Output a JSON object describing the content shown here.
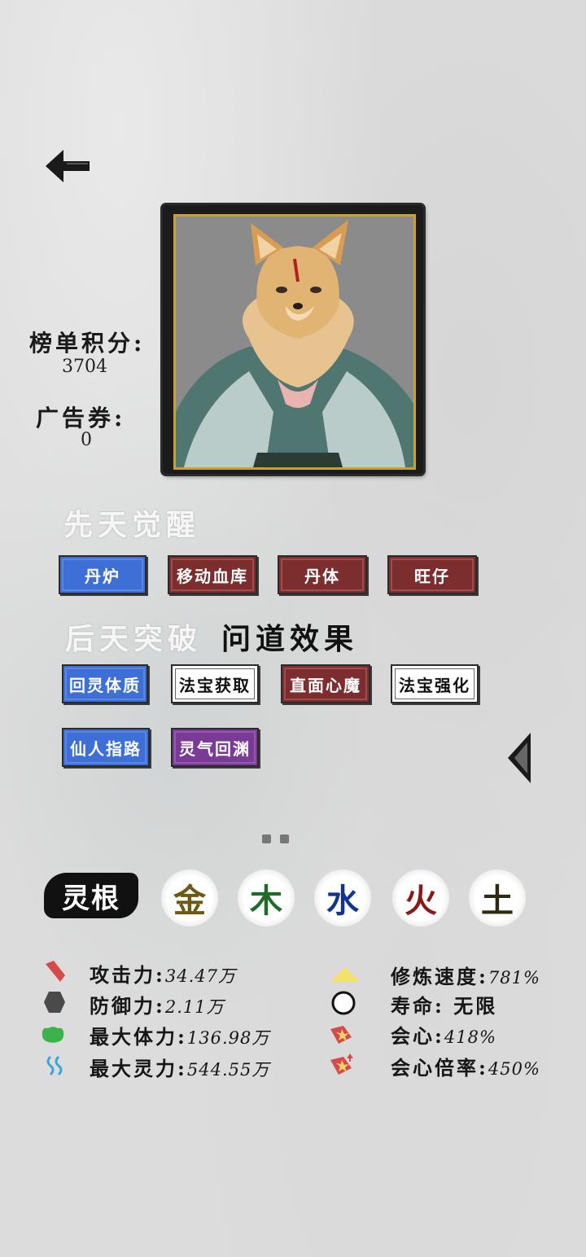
{
  "ranking": {
    "label": "榜单积分:",
    "value": "3704"
  },
  "ad_ticket": {
    "label": "广告券:",
    "value": "0"
  },
  "innate": {
    "title": "先天觉醒",
    "tags": [
      "丹炉",
      "移动血库",
      "丹体",
      "旺仔"
    ]
  },
  "acquired": {
    "title": "后天突破",
    "title_extra": "问道效果",
    "tags": [
      "回灵体质",
      "法宝获取",
      "直面心魔",
      "法宝强化",
      "仙人指路",
      "灵气回渊"
    ]
  },
  "spirit_root": {
    "label": "灵根",
    "elements": [
      {
        "char": "金",
        "color": "#6b5a12"
      },
      {
        "char": "木",
        "color": "#1f6b2a"
      },
      {
        "char": "水",
        "color": "#12348a"
      },
      {
        "char": "火",
        "color": "#8a1a1a"
      },
      {
        "char": "土",
        "color": "#2e2a12"
      }
    ]
  },
  "attributes_left": [
    {
      "name": "攻击力:",
      "value": "34.47万",
      "icon": "attack-icon"
    },
    {
      "name": "防御力:",
      "value": "2.11万",
      "icon": "defense-icon"
    },
    {
      "name": "最大体力:",
      "value": "136.98万",
      "icon": "hp-icon"
    },
    {
      "name": "最大灵力:",
      "value": "544.55万",
      "icon": "mana-icon"
    }
  ],
  "attributes_right": [
    {
      "name": "修炼速度:",
      "value": "781%",
      "icon": "cultivation-icon"
    },
    {
      "name": "寿命:",
      "value": " 无限",
      "icon": "lifespan-icon"
    },
    {
      "name": "会心:",
      "value": "418%",
      "icon": "crit-icon"
    },
    {
      "name": "会心倍率:",
      "value": "450%",
      "icon": "crit-multiplier-icon"
    }
  ]
}
